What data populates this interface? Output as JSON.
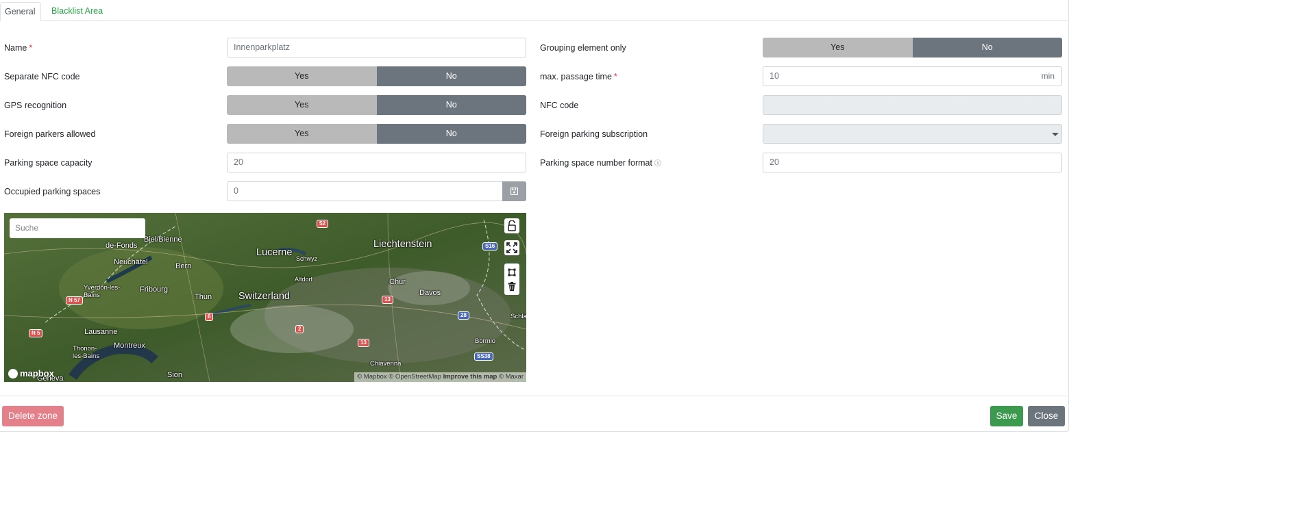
{
  "tabs": [
    {
      "label": "General",
      "active": true
    },
    {
      "label": "Blacklist Area",
      "active": false
    }
  ],
  "left": {
    "name_label": "Name",
    "name_value": "Innenparkplatz",
    "separate_nfc_label": "Separate NFC code",
    "gps_label": "GPS recognition",
    "foreign_parkers_label": "Foreign parkers allowed",
    "capacity_label": "Parking space capacity",
    "capacity_value": "20",
    "occupied_label": "Occupied parking spaces",
    "occupied_value": "0"
  },
  "right": {
    "grouping_label": "Grouping element only",
    "passage_label": "max. passage time",
    "passage_value": "10",
    "passage_unit": "min",
    "nfc_code_label": "NFC code",
    "nfc_code_value": "",
    "foreign_sub_label": "Foreign parking subscription",
    "foreign_sub_value": "",
    "number_format_label": "Parking space number format",
    "number_format_value": "20"
  },
  "toggle": {
    "yes": "Yes",
    "no": "No"
  },
  "required_mark": "*",
  "map": {
    "search_placeholder": "Suche",
    "logo": "mapbox",
    "attribution_1": "© Mapbox © OpenStreetMap",
    "attribution_2": "Improve this map",
    "attribution_3": "© Maxar",
    "places": {
      "liechtenstein": "Liechtenstein",
      "lucerne": "Lucerne",
      "switzerland": "Switzerland",
      "bern": "Bern",
      "neuchatel": "Neuchâtel",
      "fribourg": "Fribourg",
      "thun": "Thun",
      "lausanne": "Lausanne",
      "montreux": "Montreux",
      "geneva": "Geneva",
      "sion": "Sion",
      "chur": "Chur",
      "davos": "Davos",
      "schwyz": "Schwyz",
      "altdorf": "Altdorf",
      "biel": "Biel/Bienne",
      "chauxdefonds": "de-Fonds",
      "yverdon": "Yverdon-les-Bains",
      "thonon": "Thonon-les-Bains",
      "chiavenna": "Chiavenna",
      "bormio": "Bormio",
      "schla": "Schla"
    },
    "shields": {
      "s52": "52",
      "s516": "S16",
      "sn57": "N 57",
      "sn5": "N 5",
      "s6": "6",
      "s2": "2",
      "s13a": "13",
      "s13b": "13",
      "s28": "28",
      "ss38": "SS38"
    }
  },
  "footer": {
    "delete_label": "Delete zone",
    "save_label": "Save",
    "close_label": "Close"
  },
  "colors": {
    "accent_link": "#28a745",
    "save": "#3c9a4e",
    "delete": "#e4808a",
    "toggle_no": "#6c757d",
    "toggle_yes": "#b9b9b9"
  }
}
